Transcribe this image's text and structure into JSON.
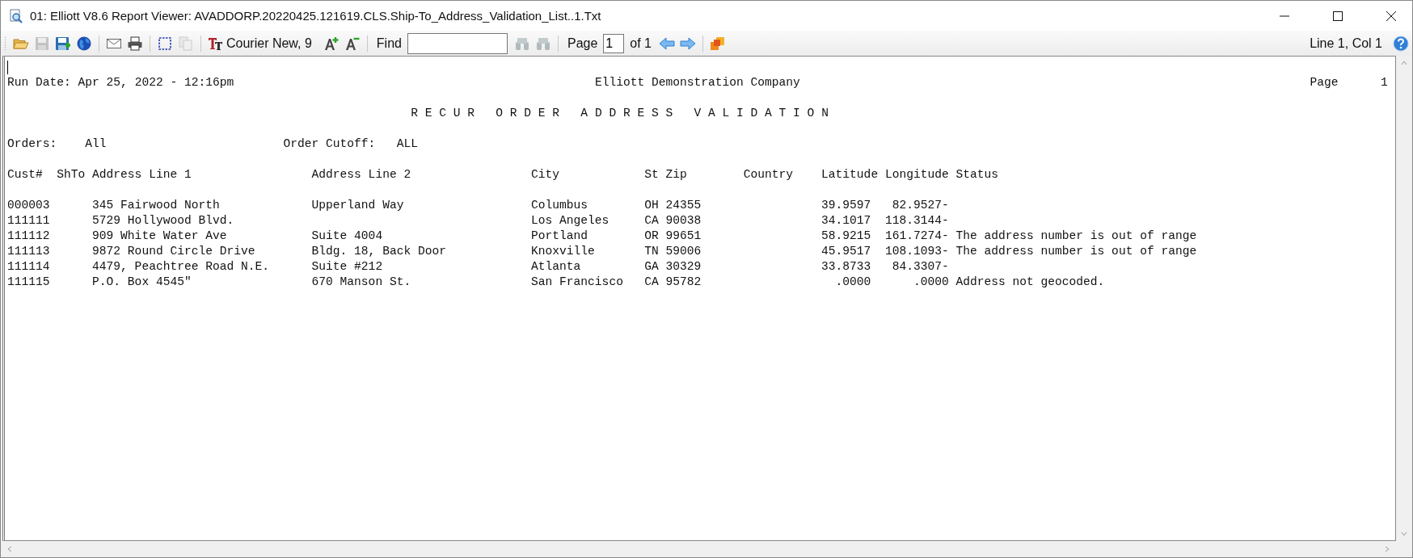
{
  "window": {
    "title": "01: Elliott V8.6 Report Viewer: AVADDORP.20220425.121619.CLS.Ship-To_Address_Validation_List..1.Txt"
  },
  "toolbar": {
    "items": [
      {
        "kind": "open",
        "disabled": false
      },
      {
        "kind": "save",
        "disabled": true
      },
      {
        "kind": "save-as",
        "disabled": false
      },
      {
        "kind": "web",
        "disabled": false
      },
      {
        "kind": "separator"
      },
      {
        "kind": "email",
        "disabled": false
      },
      {
        "kind": "print",
        "disabled": false
      },
      {
        "kind": "separator"
      },
      {
        "kind": "select",
        "disabled": false
      },
      {
        "kind": "copy",
        "disabled": true
      },
      {
        "kind": "separator"
      },
      {
        "kind": "font",
        "label": "Courier New, 9"
      },
      {
        "kind": "font-larger",
        "disabled": false
      },
      {
        "kind": "font-smaller",
        "disabled": false
      },
      {
        "kind": "separator"
      },
      {
        "kind": "find",
        "label": "Find"
      },
      {
        "kind": "find-next",
        "disabled": true
      },
      {
        "kind": "find-prev",
        "disabled": true
      },
      {
        "kind": "separator"
      },
      {
        "kind": "page",
        "label": "Page",
        "value": "1",
        "total": "of 1"
      },
      {
        "kind": "prev-page",
        "disabled": false
      },
      {
        "kind": "next-page",
        "disabled": false
      },
      {
        "kind": "separator"
      },
      {
        "kind": "export",
        "disabled": false
      }
    ],
    "position": "Line 1, Col 1"
  },
  "report": {
    "run_date": "Run Date: Apr 25, 2022 - 12:16pm",
    "company": "Elliott Demonstration Company",
    "page_label": "Page",
    "page_number": "1",
    "title": "R E C U R   O R D E R   A D D R E S S   V A L I D A T I O N",
    "filters": [
      {
        "label": "Orders:",
        "value": "All"
      },
      {
        "label": "Order Cutoff:",
        "value": "ALL"
      }
    ],
    "columns": [
      "Cust#",
      "ShTo",
      "Address Line 1",
      "Address Line 2",
      "City",
      "St",
      "Zip",
      "Country",
      "Latitude",
      "Longitude",
      "Status"
    ],
    "rows": [
      {
        "cust": "000003",
        "address1": "345 Fairwood North",
        "address2": "Upperland Way",
        "city": "Columbus",
        "state": "OH",
        "zip": "24355",
        "latitude": "39.9597",
        "longitude": "82.9527-"
      },
      {
        "cust": "111111",
        "address1": "5729 Hollywood Blvd.",
        "city": "Los Angeles",
        "state": "CA",
        "zip": "90038",
        "latitude": "34.1017",
        "longitude": "118.3144-"
      },
      {
        "cust": "111112",
        "address1": "909 White Water Ave",
        "address2": "Suite 4004",
        "city": "Portland",
        "state": "OR",
        "zip": "99651",
        "latitude": "58.9215",
        "longitude": "161.7274-",
        "status": "The address number is out of range"
      },
      {
        "cust": "111113",
        "address1": "9872 Round Circle Drive",
        "address2": "Bldg. 18, Back Door",
        "city": "Knoxville",
        "state": "TN",
        "zip": "59006",
        "latitude": "45.9517",
        "longitude": "108.1093-",
        "status": "The address number is out of range"
      },
      {
        "cust": "111114",
        "address1": "4479, Peachtree Road N.E.",
        "address2": "Suite #212",
        "city": "Atlanta",
        "state": "GA",
        "zip": "30329",
        "latitude": "33.8733",
        "longitude": "84.3307-"
      },
      {
        "cust": "111115",
        "address1": "P.O. Box 4545\"",
        "address2": "670 Manson St.",
        "city": "San Francisco",
        "state": "CA",
        "zip": "95782",
        "latitude": ".0000",
        "longitude": ".0000",
        "status": "Address not geocoded."
      }
    ]
  }
}
